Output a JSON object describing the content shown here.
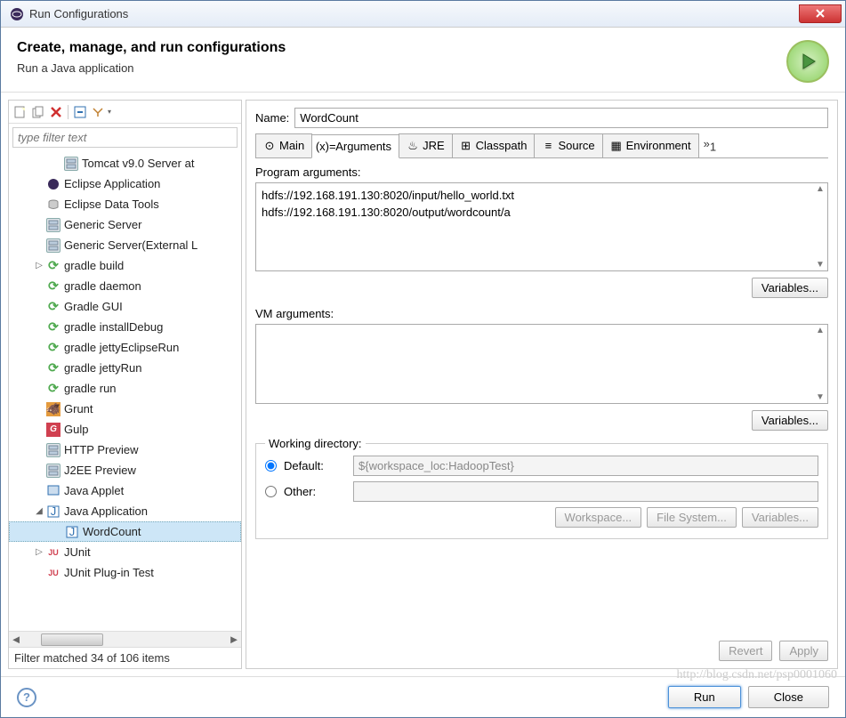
{
  "window_title": "Run Configurations",
  "header": {
    "title": "Create, manage, and run configurations",
    "subtitle": "Run a Java application"
  },
  "toolbar": {
    "filter_placeholder": "type filter text"
  },
  "tree": {
    "items": [
      {
        "label": "Tomcat v9.0 Server at",
        "icon": "server",
        "indent": "indent2"
      },
      {
        "label": "Eclipse Application",
        "icon": "eclipse",
        "indent": "indent1"
      },
      {
        "label": "Eclipse Data Tools",
        "icon": "db",
        "indent": "indent1"
      },
      {
        "label": "Generic Server",
        "icon": "server",
        "indent": "indent1"
      },
      {
        "label": "Generic Server(External L",
        "icon": "server",
        "indent": "indent1"
      },
      {
        "label": "gradle build",
        "icon": "gradle",
        "indent": "indent1",
        "twisty": "▷"
      },
      {
        "label": "gradle daemon",
        "icon": "gradle",
        "indent": "indent1"
      },
      {
        "label": "Gradle GUI",
        "icon": "gradle",
        "indent": "indent1"
      },
      {
        "label": "gradle installDebug",
        "icon": "gradle",
        "indent": "indent1"
      },
      {
        "label": "gradle jettyEclipseRun",
        "icon": "gradle",
        "indent": "indent1"
      },
      {
        "label": "gradle jettyRun",
        "icon": "gradle",
        "indent": "indent1"
      },
      {
        "label": "gradle run",
        "icon": "gradle",
        "indent": "indent1"
      },
      {
        "label": "Grunt",
        "icon": "grunt",
        "indent": "indent1"
      },
      {
        "label": "Gulp",
        "icon": "gulp",
        "indent": "indent1"
      },
      {
        "label": "HTTP Preview",
        "icon": "server",
        "indent": "indent1"
      },
      {
        "label": "J2EE Preview",
        "icon": "server",
        "indent": "indent1"
      },
      {
        "label": "Java Applet",
        "icon": "applet",
        "indent": "indent1"
      },
      {
        "label": "Java Application",
        "icon": "java",
        "indent": "indent1",
        "twisty": "◢"
      },
      {
        "label": "WordCount",
        "icon": "java",
        "indent": "indent2",
        "selected": true
      },
      {
        "label": "JUnit",
        "icon": "junit",
        "indent": "indent1",
        "twisty": "▷"
      },
      {
        "label": "JUnit Plug-in Test",
        "icon": "junit",
        "indent": "indent1"
      }
    ]
  },
  "filter_status": "Filter matched 34 of 106 items",
  "name_label": "Name:",
  "name_value": "WordCount",
  "tabs": [
    {
      "label": "Main",
      "icon": "main"
    },
    {
      "label": "Arguments",
      "icon": "args",
      "active": true
    },
    {
      "label": "JRE",
      "icon": "jre"
    },
    {
      "label": "Classpath",
      "icon": "classpath"
    },
    {
      "label": "Source",
      "icon": "source"
    },
    {
      "label": "Environment",
      "icon": "env"
    }
  ],
  "tab_overflow": "»₁",
  "program_args": {
    "label": "Program arguments:",
    "value": "hdfs://192.168.191.130:8020/input/hello_world.txt\nhdfs://192.168.191.130:8020/output/wordcount/a",
    "variables_btn": "Variables..."
  },
  "vm_args": {
    "label": "VM arguments:",
    "value": "",
    "variables_btn": "Variables..."
  },
  "working_dir": {
    "legend": "Working directory:",
    "default_label": "Default:",
    "default_value": "${workspace_loc:HadoopTest}",
    "other_label": "Other:",
    "other_value": "",
    "workspace_btn": "Workspace...",
    "filesystem_btn": "File System...",
    "variables_btn": "Variables..."
  },
  "revert_btn": "Revert",
  "apply_btn": "Apply",
  "run_btn": "Run",
  "close_btn": "Close",
  "watermark": "http://blog.csdn.net/psp0001060"
}
